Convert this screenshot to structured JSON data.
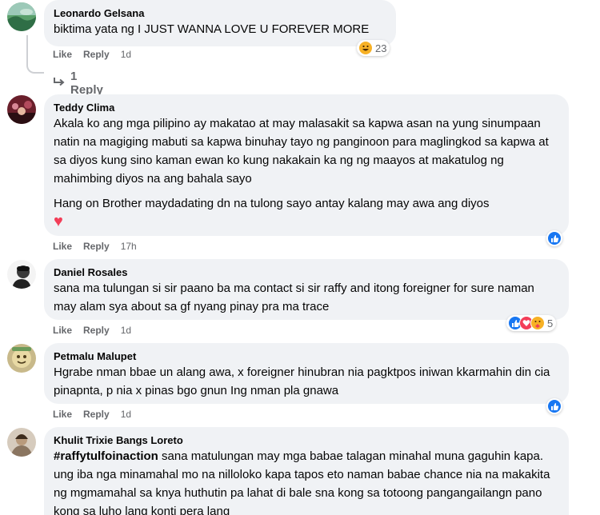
{
  "comments": [
    {
      "author": "Leonardo Gelsana",
      "paragraphs": [
        "biktima yata ng I JUST WANNA LOVE U FOREVER MORE"
      ],
      "like_label": "Like",
      "reply_label": "Reply",
      "time": "1d",
      "reaction_icons": [
        "haha-icon"
      ],
      "reaction_count": "23",
      "replies_label": "1 Reply"
    },
    {
      "author": "Teddy Clima",
      "paragraphs": [
        "Akala ko ang mga pilipino ay makatao at may malasakit sa kapwa asan na yung sinumpaan natin na magiging mabuti sa kapwa binuhay tayo ng panginoon para maglingkod sa kapwa at sa diyos kung sino kaman ewan ko kung nakakain ka ng ng maayos at makatulog ng mahimbing diyos na ang bahala sayo",
        "Hang on Brother maydadating dn na tulong sayo antay kalang may awa ang diyos"
      ],
      "heart_emoji": "♥",
      "like_label": "Like",
      "reply_label": "Reply",
      "time": "17h",
      "reaction_icons": [
        "like-icon"
      ],
      "reaction_count": ""
    },
    {
      "author": "Daniel Rosales",
      "paragraphs": [
        "sana ma tulungan si sir paano ba ma contact si sir raffy and itong foreigner for sure naman may alam sya about sa gf nyang pinay pra ma trace"
      ],
      "like_label": "Like",
      "reply_label": "Reply",
      "time": "1d",
      "reaction_icons": [
        "like-icon",
        "love-icon",
        "care-icon"
      ],
      "reaction_count": "5"
    },
    {
      "author": "Petmalu Malupet",
      "paragraphs": [
        "Hgrabe nman bbae un alang awa, x foreigner hinubran nia pagktpos iniwan kkarmahin din cia pinapnta, p nia x pinas bgo gnun Ing nman pla gnawa"
      ],
      "like_label": "Like",
      "reply_label": "Reply",
      "time": "1d",
      "reaction_icons": [
        "like-icon"
      ],
      "reaction_count": ""
    },
    {
      "author": "Khulit Trixie Bangs Loreto",
      "hashtag": "#raffytulfoinaction",
      "paragraphs": [
        "sana matulungan may mga babae talagan minahal muna gaguhin kapa. ung iba nga minamahal mo na nilloloko kapa tapos eto naman babae chance nia na makakita ng mgmamahal sa knya huthutin pa lahat di bale sna kong sa totoong pangangailangn pano kong sa luho lang konti pera lang"
      ]
    }
  ],
  "colors": {
    "bubble": "#f0f2f5",
    "secondary_text": "#65676b",
    "like_blue": "#1877f2",
    "love_red": "#f33e58",
    "haha_yellow": "#f7b125"
  }
}
